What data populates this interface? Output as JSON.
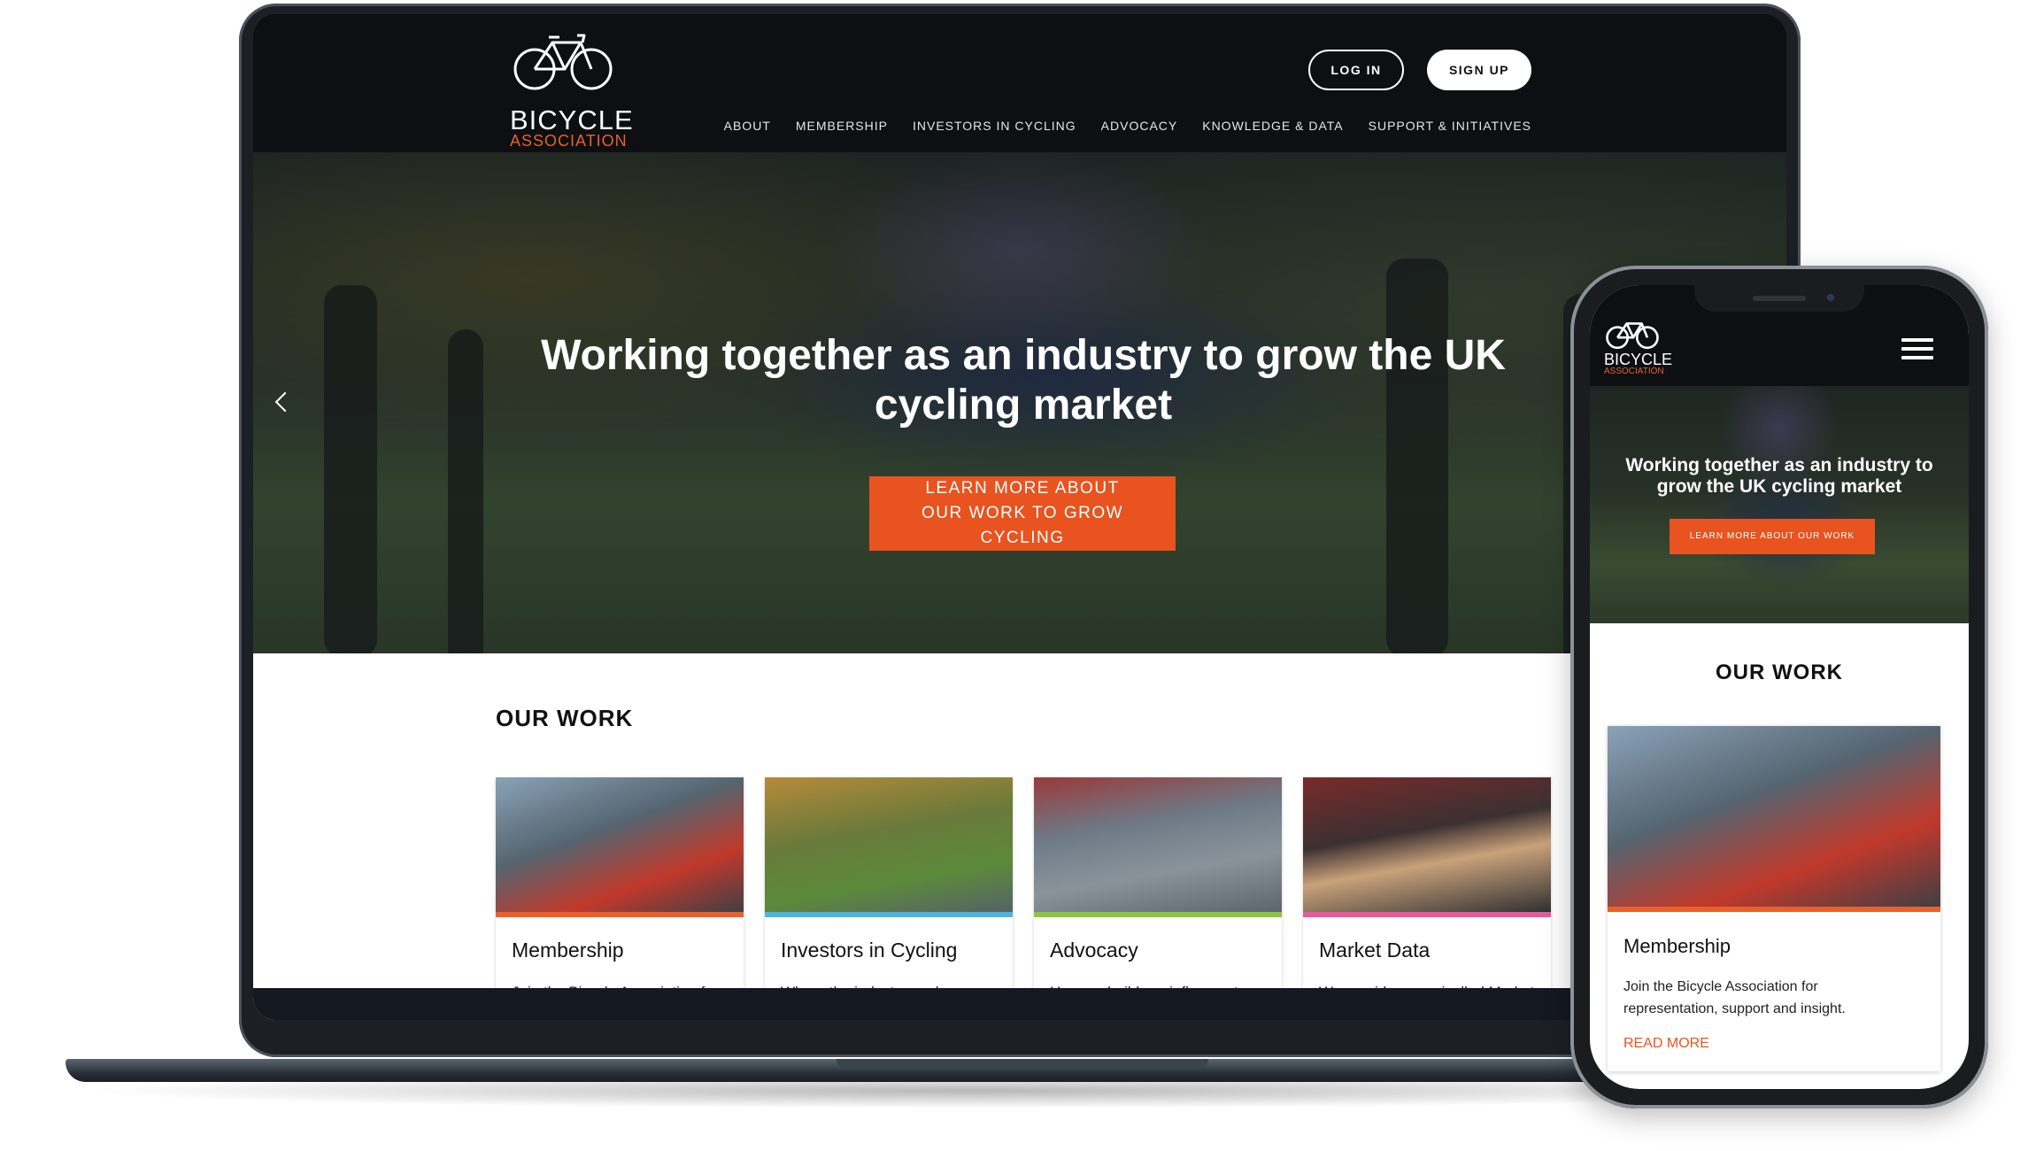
{
  "site": {
    "logo_line1": "BICYCLE",
    "logo_line2": "ASSOCIATION",
    "login_label": "LOG IN",
    "signup_label": "SIGN UP",
    "nav": [
      "ABOUT",
      "MEMBERSHIP",
      "INVESTORS IN CYCLING",
      "ADVOCACY",
      "KNOWLEDGE & DATA",
      "SUPPORT & INITIATIVES"
    ]
  },
  "hero": {
    "title": "Working together as an industry to grow the UK cycling market",
    "cta_label": "LEARN MORE ABOUT OUR WORK TO GROW CYCLING"
  },
  "work": {
    "title": "OUR WORK",
    "cards": [
      {
        "title": "Membership",
        "text": "Join the Bicycle Association for representation, support and insight.",
        "accent": "#e8612c"
      },
      {
        "title": "Investors in Cycling",
        "text": "Where the industry works together to grow the cycling market.",
        "accent": "#4fb3e0"
      },
      {
        "title": "Advocacy",
        "text": "How we build our influence to grow the market and benefit the entire cycling community.",
        "accent": "#8cc63f"
      },
      {
        "title": "Market Data",
        "text": "We provide an unrivalled Market Data Service to strengthen and inform the...",
        "accent": "#e85a9a"
      }
    ]
  },
  "mobile": {
    "logo_line1": "BICYCLE",
    "logo_line2": "ASSOCIATION",
    "hero_title": "Working together as an industry to grow the UK cycling market",
    "cta_label": "LEARN MORE ABOUT OUR WORK",
    "work_title": "OUR WORK",
    "card_title": "Membership",
    "card_text": "Join the Bicycle Association for representation, support and insight.",
    "read_more": "READ MORE"
  },
  "colors": {
    "accent": "#e8531f",
    "header_bg": "#0d0f13"
  }
}
